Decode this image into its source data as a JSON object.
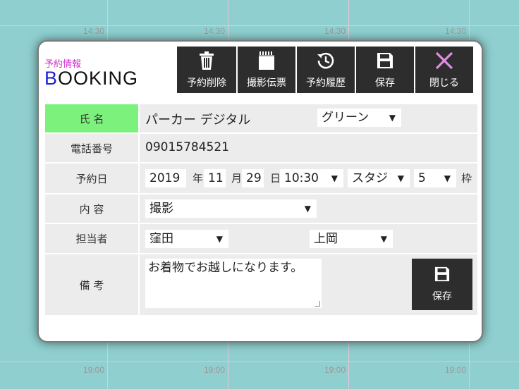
{
  "background": {
    "time_top": [
      "14:30",
      "14:30",
      "14:30",
      "14:30"
    ],
    "time_bottom": [
      "19:00",
      "19:00",
      "19:00",
      "19:00"
    ]
  },
  "header": {
    "subtitle": "予約情報",
    "title_first": "B",
    "title_rest": "OOKING"
  },
  "toolbar": [
    {
      "label": "予約削除",
      "icon": "trash-icon"
    },
    {
      "label": "撮影伝票",
      "icon": "notepad-icon"
    },
    {
      "label": "予約履歴",
      "icon": "history-icon"
    },
    {
      "label": "保存",
      "icon": "save-icon"
    },
    {
      "label": "閉じる",
      "icon": "close-icon"
    }
  ],
  "form": {
    "name": {
      "label": "氏 名",
      "value": "パーカー デジタル",
      "plan": "グリーン"
    },
    "phone": {
      "label": "電話番号",
      "value": "09015784521"
    },
    "date": {
      "label": "予約日",
      "year": "2019",
      "year_unit": "年",
      "month": "11",
      "month_unit": "月",
      "day": "29",
      "day_unit": "日",
      "time": "10:30",
      "studio": "スタジ",
      "slots": "5",
      "slot_unit": "枠"
    },
    "content": {
      "label": "内 容",
      "value": "撮影"
    },
    "staff": {
      "label": "担当者",
      "primary": "窪田",
      "secondary": "上岡"
    },
    "notes": {
      "label": "備 考",
      "value": "お着物でお越しになります。",
      "save_label": "保存"
    }
  },
  "colors": {
    "accent_title": "#1f1fd6",
    "subtitle": "#d02fd0",
    "name_label_bg": "#7cf27c",
    "toolbar_bg": "#2d2d2d",
    "close_icon": "#e589e5"
  }
}
